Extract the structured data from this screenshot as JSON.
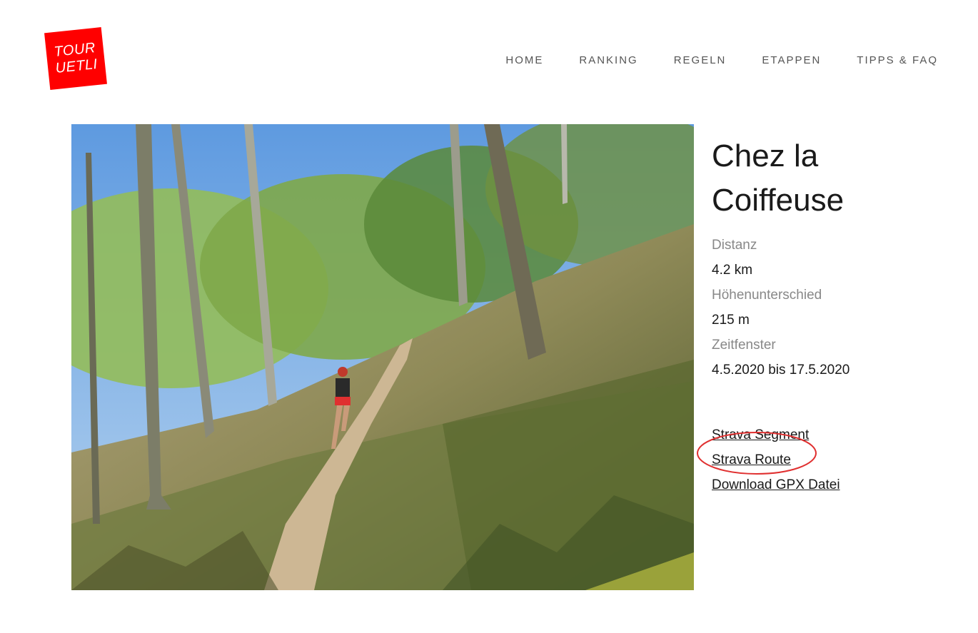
{
  "brand": {
    "logo_line1": "TOUR",
    "logo_line2": "UETLI"
  },
  "nav": {
    "items": [
      "HOME",
      "RANKING",
      "REGELN",
      "ETAPPEN",
      "TIPPS & FAQ"
    ]
  },
  "stage": {
    "title_line1": "Chez la",
    "title_line2": "Coiffeuse",
    "distance_label": "Distanz",
    "distance_value": "4.2 km",
    "elevation_label": "Höhenunterschied",
    "elevation_value": "215 m",
    "window_label": "Zeitfenster",
    "window_value": "4.5.2020 bis 17.5.2020"
  },
  "links": {
    "segment": "Strava Segment",
    "route": "Strava Route",
    "gpx": "Download GPX Datei"
  },
  "colors": {
    "brand_red": "#ff0000",
    "annotation_red": "#e03030"
  }
}
